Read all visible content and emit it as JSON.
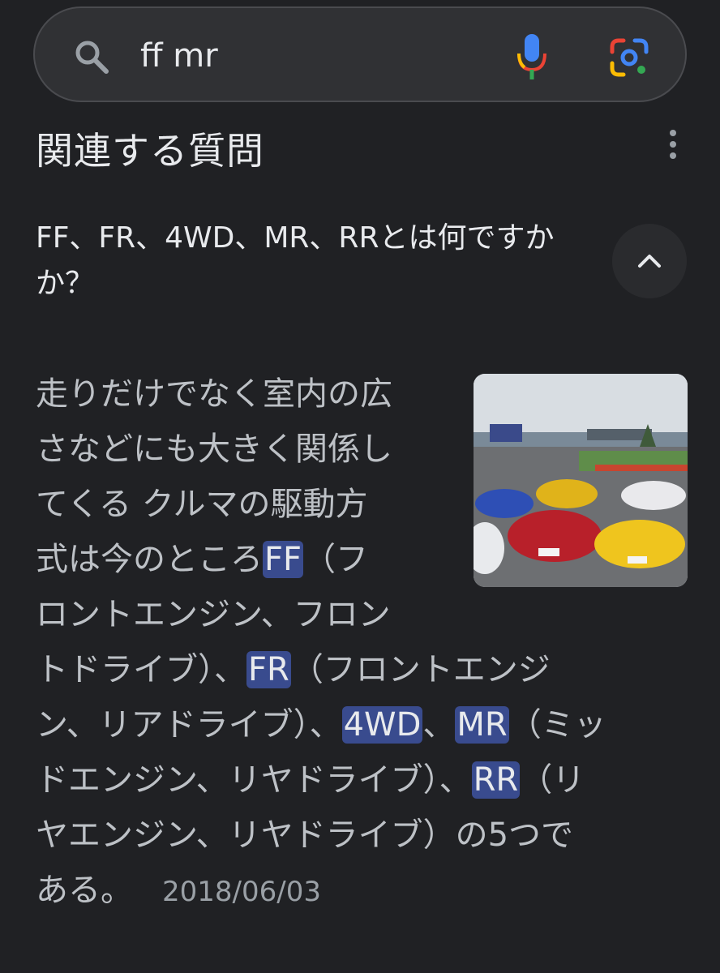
{
  "search": {
    "query": "ff mr",
    "icons": {
      "search": "search-icon",
      "mic": "mic-icon",
      "lens": "google-lens-icon"
    }
  },
  "related": {
    "title": "関連する質問",
    "question_line1": "FF、FR、4WD、MR、RRとは何ですか",
    "question_line2": "か？",
    "answer_lines": [
      {
        "text": "走りだけでなく室内の広"
      },
      {
        "text": "さなどにも大きく関係し"
      },
      {
        "text": "てくる クルマの駆動方"
      },
      {
        "before": "式は今のところ",
        "hl": "FF",
        "after": "（フ"
      },
      {
        "text": "ロントエンジン、フロン"
      },
      {
        "before": "トドライブ）、",
        "hl": "FR",
        "after": "（フロントエンジ"
      },
      {
        "before": "ン、リアドライブ）、",
        "hl": "4WD",
        "mid": "、",
        "hl2": "MR",
        "after": "（ミッ"
      },
      {
        "before": "ドエンジン、リヤドライブ）、",
        "hl": "RR",
        "after": "（リ"
      },
      {
        "text": "ヤエンジン、リヤドライブ）の5つで"
      }
    ],
    "answer_last": "ある。",
    "date": "2018/06/03"
  },
  "colors": {
    "background": "#202124",
    "highlight": "#394b8e",
    "text_secondary": "#bdc1c6"
  }
}
